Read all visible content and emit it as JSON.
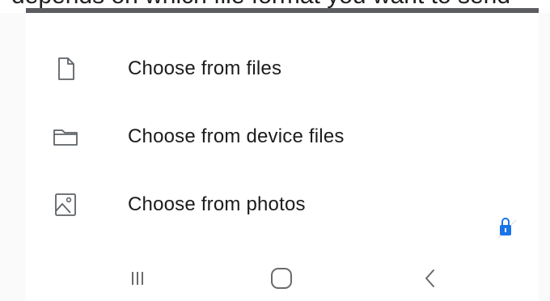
{
  "background_text": "depends on which file format you want to send",
  "sheet": {
    "items": [
      {
        "label": "Choose from files",
        "icon": "file-icon"
      },
      {
        "label": "Choose from device files",
        "icon": "folder-icon"
      },
      {
        "label": "Choose from photos",
        "icon": "image-icon"
      }
    ]
  },
  "navigation_bar": {
    "buttons": [
      {
        "icon": "recent-apps-icon"
      },
      {
        "icon": "home-icon"
      },
      {
        "icon": "back-icon"
      }
    ]
  },
  "colors": {
    "sheet_background": "#ffffff",
    "page_background": "#fafafb",
    "top_bar": "#5b5d61",
    "icon_stroke": "#5f6368",
    "text": "#1c1c1c",
    "lock_badge": "#1a73e8"
  }
}
